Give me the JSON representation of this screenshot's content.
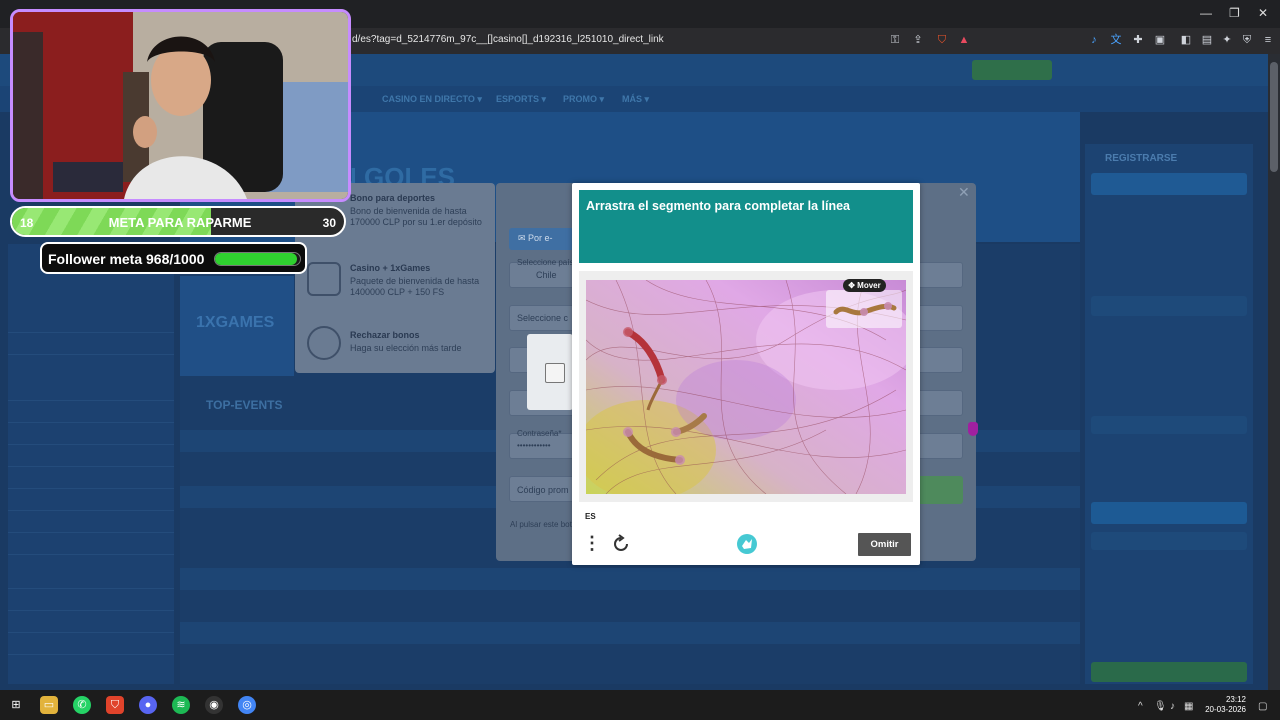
{
  "browser": {
    "url": "d/es?tag=d_5214776m_97c__[]casino[]_d192316_l251010_direct_link",
    "window_controls": [
      "—",
      "❐",
      "✕"
    ]
  },
  "site": {
    "nav": [
      "CASINO EN DIRECTO ▾",
      "ESPORTS ▾",
      "PROMO ▾",
      "MÁS ▾"
    ],
    "hero_title": "N GOLES",
    "games_banner": "1XGAMES",
    "top_events": "TOP-EVENTS",
    "register_title": "REGISTRARSE"
  },
  "registration": {
    "bonuses": [
      {
        "title": "Bono para deportes",
        "desc": "Bono de bienvenida de hasta 170000 CLP por su 1.er depósito"
      },
      {
        "title": "Casino + 1xGames",
        "desc": "Paquete de bienvenida de hasta 1400000 CLP + 150 FS"
      },
      {
        "title": "Rechazar bonos",
        "desc": "Haga su elección más tarde"
      }
    ],
    "tab_label": "✉ Por e-",
    "country_label": "Seleccione país",
    "country_value": "Chile",
    "select_label": "Seleccione c",
    "password_label": "Contraseña*",
    "password_value": "••••••••••••",
    "promo_placeholder": "Código prom",
    "footer_text": "Al pulsar este bot"
  },
  "captcha": {
    "prompt": "Arrastra el segmento para completar la línea",
    "move_label": "✥ Mover",
    "language": "ES",
    "skip_label": "Omitir"
  },
  "overlay": {
    "meta_left": "18",
    "meta_label": "META PARA RAPARME",
    "meta_right": "30",
    "meta_progress": 0.6,
    "follower_text": "Follower meta 968/1000",
    "follower_progress": 0.968
  },
  "taskbar": {
    "time": "23:12",
    "date": "20-03-2026"
  }
}
